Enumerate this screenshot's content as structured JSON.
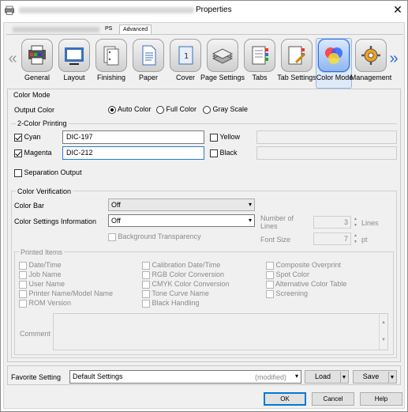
{
  "window": {
    "title": "Properties",
    "close_glyph": "✕",
    "app_icon": "printer-icon"
  },
  "tabs": [
    {
      "label": "PS"
    },
    {
      "label": "Advanced"
    }
  ],
  "nav": {
    "left_arrow": "«",
    "right_arrow": "»"
  },
  "categories": [
    {
      "label": "General",
      "icon": "general-icon"
    },
    {
      "label": "Layout",
      "icon": "layout-icon"
    },
    {
      "label": "Finishing",
      "icon": "finishing-icon"
    },
    {
      "label": "Paper",
      "icon": "paper-icon"
    },
    {
      "label": "Cover",
      "icon": "cover-icon"
    },
    {
      "label": "Page Settings",
      "icon": "page-settings-icon"
    },
    {
      "label": "Tabs",
      "icon": "tabs-icon"
    },
    {
      "label": "Tab Settings",
      "icon": "tab-settings-icon"
    },
    {
      "label": "Color Mode",
      "icon": "color-mode-icon",
      "selected": true
    },
    {
      "label": "Management",
      "icon": "management-icon"
    }
  ],
  "color_mode": {
    "section_label": "Color Mode",
    "output_color_label": "Output Color",
    "output_options": [
      {
        "label": "Auto Color",
        "selected": true
      },
      {
        "label": "Full Color",
        "selected": false
      },
      {
        "label": "Gray Scale",
        "selected": false
      }
    ],
    "two_color_label": "2-Color Printing",
    "cyan": {
      "label": "Cyan",
      "checked": true,
      "value": "DIC-197"
    },
    "magenta": {
      "label": "Magenta",
      "checked": true,
      "value": "DIC-212"
    },
    "yellow": {
      "label": "Yellow",
      "checked": false,
      "value": ""
    },
    "black": {
      "label": "Black",
      "checked": false,
      "value": ""
    },
    "separation_output": {
      "label": "Separation Output",
      "checked": false
    }
  },
  "color_verification": {
    "section_label": "Color Verification",
    "color_bar_label": "Color Bar",
    "color_bar_value": "Off",
    "settings_info_label": "Color Settings Information",
    "settings_info_value": "Off",
    "background_transparency": "Background Transparency",
    "number_of_lines_label": "Number of Lines",
    "number_of_lines_value": "3",
    "lines_unit": "Lines",
    "font_size_label": "Font Size",
    "font_size_value": "7",
    "font_unit": "pt"
  },
  "printed_items": {
    "label": "Printed Items",
    "col1": [
      "Date/Time",
      "Job Name",
      "User Name",
      "Printer Name/Model Name",
      "ROM Version"
    ],
    "col2": [
      "Calibration Date/Time",
      "RGB Color Conversion",
      "CMYK Color Conversion",
      "Tone Curve Name",
      "Black Handling"
    ],
    "col3": [
      "Composite Overprint",
      "Spot Color",
      "Alternative Color Table",
      "Screening"
    ],
    "comment_label": "Comment"
  },
  "footer": {
    "favorite_label": "Favorite Setting",
    "favorite_value": "Default Settings",
    "favorite_status": "(modified)",
    "load_label": "Load",
    "save_label": "Save",
    "ok_label": "OK",
    "cancel_label": "Cancel",
    "help_label": "Help"
  },
  "colors": {
    "accent": "#0078d7",
    "selected_tab": "#dfeaf8"
  }
}
